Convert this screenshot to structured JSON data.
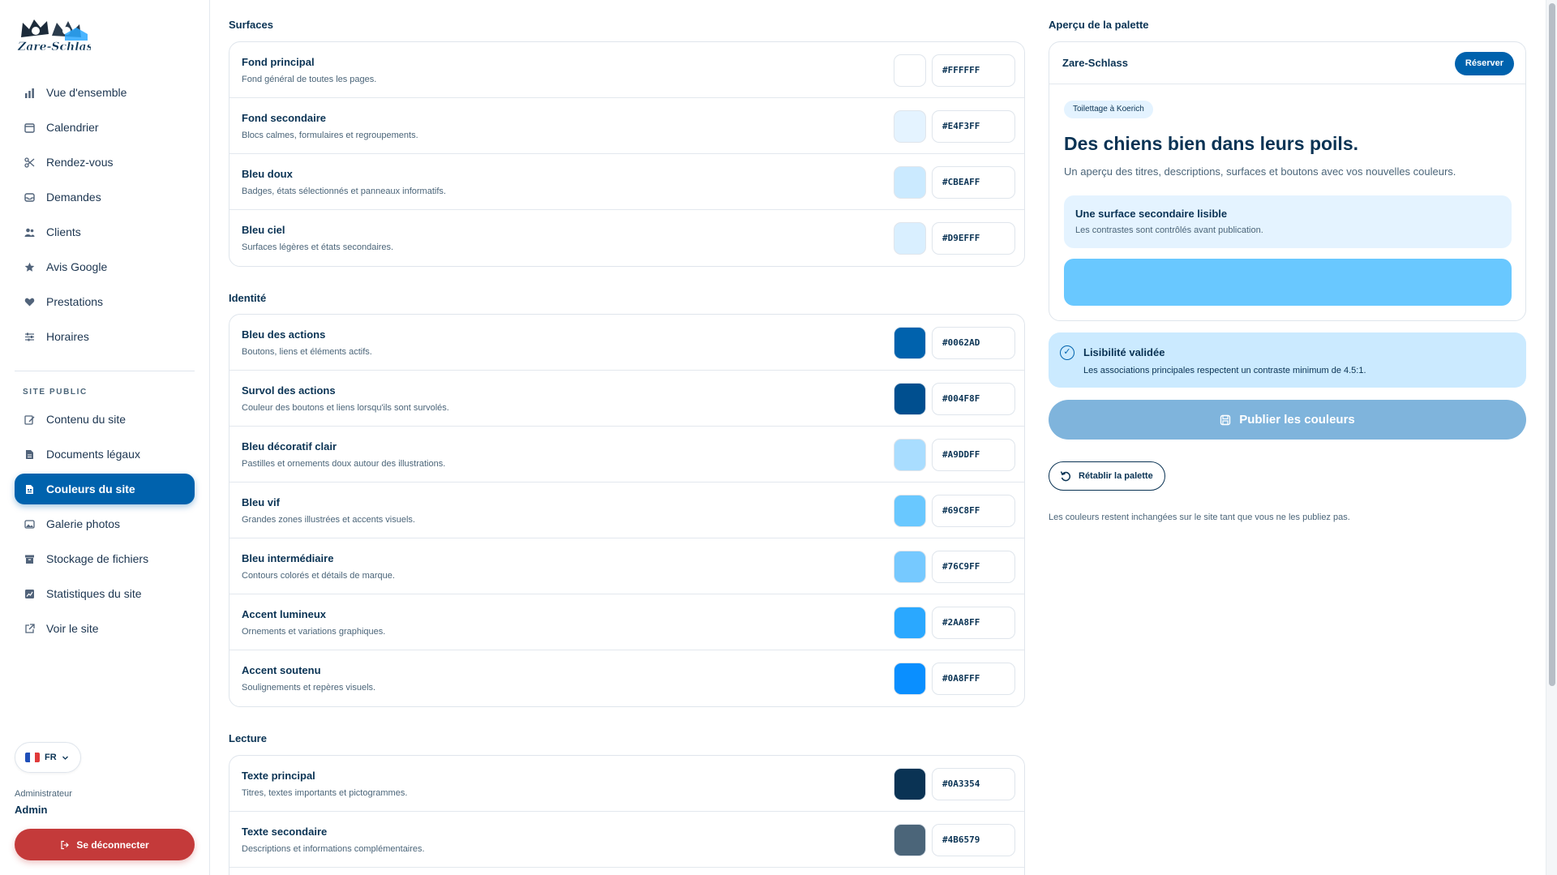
{
  "sidebar": {
    "logo_text": "Zare-Schlass",
    "nav": [
      {
        "label": "Vue d'ensemble",
        "icon": "bar-chart-icon"
      },
      {
        "label": "Calendrier",
        "icon": "calendar-icon"
      },
      {
        "label": "Rendez-vous",
        "icon": "scissors-icon"
      },
      {
        "label": "Demandes",
        "icon": "inbox-icon"
      },
      {
        "label": "Clients",
        "icon": "users-icon"
      },
      {
        "label": "Avis Google",
        "icon": "star-icon"
      },
      {
        "label": "Prestations",
        "icon": "heart-icon"
      },
      {
        "label": "Horaires",
        "icon": "sliders-icon"
      }
    ],
    "section_label": "SITE PUBLIC",
    "nav2": [
      {
        "label": "Contenu du site",
        "icon": "edit-icon"
      },
      {
        "label": "Documents légaux",
        "icon": "document-icon"
      },
      {
        "label": "Couleurs du site",
        "icon": "palette-icon",
        "active": true
      },
      {
        "label": "Galerie photos",
        "icon": "image-icon"
      },
      {
        "label": "Stockage de fichiers",
        "icon": "archive-icon"
      },
      {
        "label": "Statistiques du site",
        "icon": "stats-icon"
      },
      {
        "label": "Voir le site",
        "icon": "external-link-icon"
      }
    ],
    "language": "FR",
    "admin_role": "Administrateur",
    "admin_name": "Admin",
    "logout_label": "Se déconnecter"
  },
  "groups": [
    {
      "title": "Surfaces",
      "rows": [
        {
          "name": "Fond principal",
          "desc": "Fond général de toutes les pages.",
          "hex": "#FFFFFF"
        },
        {
          "name": "Fond secondaire",
          "desc": "Blocs calmes, formulaires et regroupements.",
          "hex": "#E4F3FF"
        },
        {
          "name": "Bleu doux",
          "desc": "Badges, états sélectionnés et panneaux informatifs.",
          "hex": "#CBEAFF"
        },
        {
          "name": "Bleu ciel",
          "desc": "Surfaces légères et états secondaires.",
          "hex": "#D9EFFF"
        }
      ]
    },
    {
      "title": "Identité",
      "rows": [
        {
          "name": "Bleu des actions",
          "desc": "Boutons, liens et éléments actifs.",
          "hex": "#0062AD"
        },
        {
          "name": "Survol des actions",
          "desc": "Couleur des boutons et liens lorsqu'ils sont survolés.",
          "hex": "#004F8F"
        },
        {
          "name": "Bleu décoratif clair",
          "desc": "Pastilles et ornements doux autour des illustrations.",
          "hex": "#A9DDFF"
        },
        {
          "name": "Bleu vif",
          "desc": "Grandes zones illustrées et accents visuels.",
          "hex": "#69C8FF"
        },
        {
          "name": "Bleu intermédiaire",
          "desc": "Contours colorés et détails de marque.",
          "hex": "#76C9FF"
        },
        {
          "name": "Accent lumineux",
          "desc": "Ornements et variations graphiques.",
          "hex": "#2AA8FF"
        },
        {
          "name": "Accent soutenu",
          "desc": "Soulignements et repères visuels.",
          "hex": "#0A8FFF"
        }
      ]
    },
    {
      "title": "Lecture",
      "rows": [
        {
          "name": "Texte principal",
          "desc": "Titres, textes importants et pictogrammes.",
          "hex": "#0A3354"
        },
        {
          "name": "Texte secondaire",
          "desc": "Descriptions et informations complémentaires.",
          "hex": "#4B6579"
        }
      ]
    }
  ],
  "preview": {
    "title": "Aperçu de la palette",
    "brand": "Zare-Schlass",
    "reserve_label": "Réserver",
    "badge": "Toilettage à Koerich",
    "headline": "Des chiens bien dans leurs poils.",
    "paragraph": "Un aperçu des titres, descriptions, surfaces et boutons avec vos nouvelles couleurs.",
    "surface_title": "Une surface secondaire lisible",
    "surface_text": "Les contrastes sont contrôlés avant publication.",
    "check_title": "Lisibilité validée",
    "check_text": "Les associations principales respectent un contraste minimum de 4.5:1.",
    "publish_label": "Publier les couleurs",
    "reset_label": "Rétablir la palette",
    "note": "Les couleurs restent inchangées sur le site tant que vous ne les publiez pas."
  }
}
